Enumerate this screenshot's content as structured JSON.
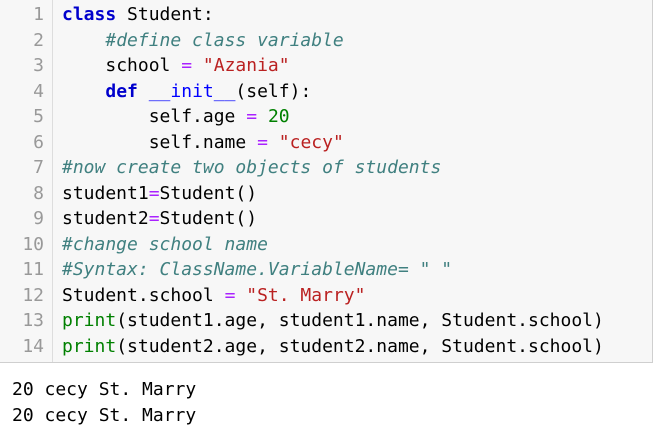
{
  "code_lines": [
    {
      "num": "1"
    },
    {
      "num": "2"
    },
    {
      "num": "3"
    },
    {
      "num": "4"
    },
    {
      "num": "5"
    },
    {
      "num": "6"
    },
    {
      "num": "7"
    },
    {
      "num": "8"
    },
    {
      "num": "9"
    },
    {
      "num": "10"
    },
    {
      "num": "11"
    },
    {
      "num": "12"
    },
    {
      "num": "13"
    },
    {
      "num": "14"
    }
  ],
  "tokens": {
    "l1_kw": "class",
    "l1_rest": " Student:",
    "l2_cm": "#define class variable",
    "l3_a": "school ",
    "l3_op": "=",
    "l3_sp": " ",
    "l3_st": "\"Azania\"",
    "l4_kw": "def",
    "l4_sp": " ",
    "l4_fn": "__init__",
    "l4_rest": "(self):",
    "l5_a": "self.age ",
    "l5_op": "=",
    "l5_sp": " ",
    "l5_nm": "20",
    "l6_a": "self.name ",
    "l6_op": "=",
    "l6_sp": " ",
    "l6_st": "\"cecy\"",
    "l7_cm": "#now create two objects of students",
    "l8_a": "student1",
    "l8_op": "=",
    "l8_b": "Student()",
    "l9_a": "student2",
    "l9_op": "=",
    "l9_b": "Student()",
    "l10_cm": "#change school name",
    "l11_cm": "#Syntax: ClassName.VariableName= \" \"",
    "l12_a": "Student.school ",
    "l12_op": "=",
    "l12_sp": " ",
    "l12_st": "\"St. Marry\"",
    "l13_kw": "print",
    "l13_rest": "(student1.age, student1.name, Student.school)",
    "l14_kw": "print",
    "l14_rest": "(student2.age, student2.name, Student.school)"
  },
  "output": [
    "20 cecy St. Marry",
    "20 cecy St. Marry"
  ]
}
